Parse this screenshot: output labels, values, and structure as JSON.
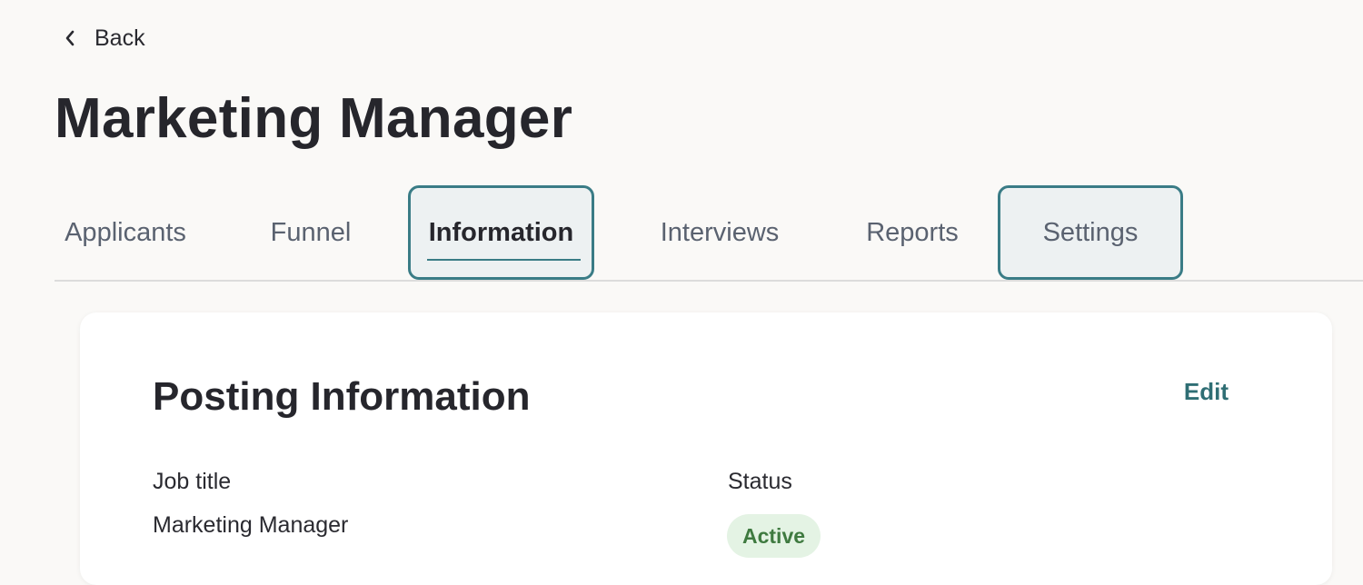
{
  "nav": {
    "back_label": "Back"
  },
  "page": {
    "title": "Marketing Manager"
  },
  "tabs": [
    {
      "label": "Applicants"
    },
    {
      "label": "Funnel"
    },
    {
      "label": "Information"
    },
    {
      "label": "Interviews"
    },
    {
      "label": "Reports"
    },
    {
      "label": "Settings"
    }
  ],
  "card": {
    "title": "Posting Information",
    "edit_label": "Edit",
    "fields": {
      "job_title_label": "Job title",
      "job_title_value": "Marketing Manager",
      "status_label": "Status",
      "status_value": "Active"
    }
  },
  "colors": {
    "accent": "#3a7c86",
    "link": "#2f6e74",
    "status_active_bg": "#e4f3e4",
    "status_active_text": "#3f7a40"
  }
}
